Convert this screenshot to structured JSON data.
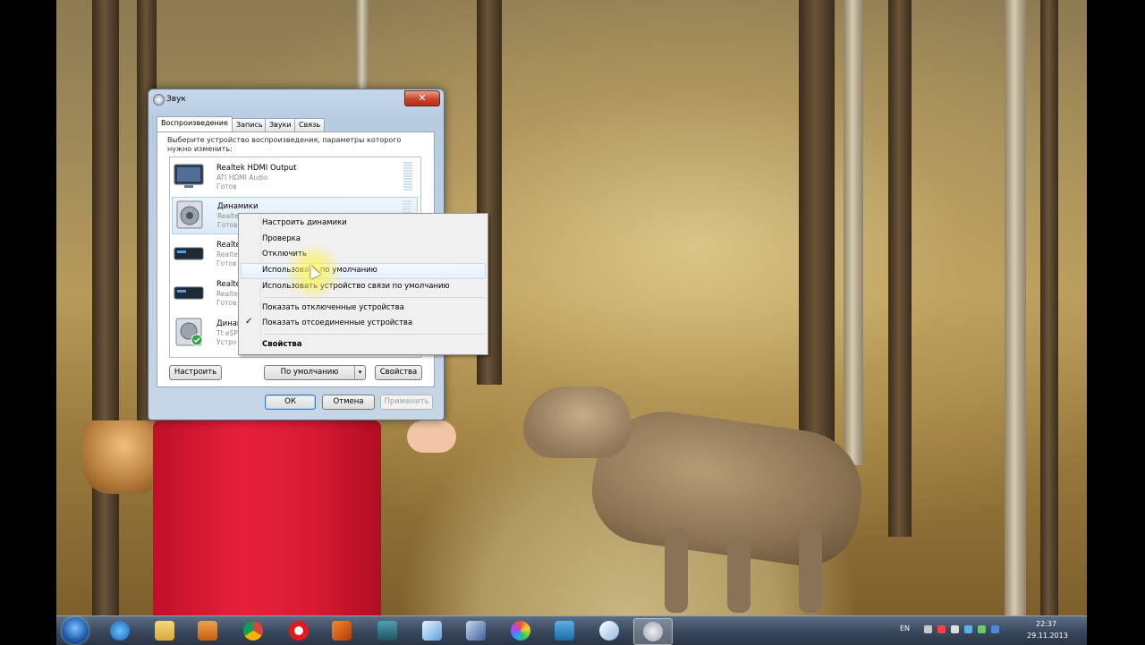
{
  "window": {
    "title": "Звук",
    "close_label": "✕",
    "tabs": [
      "Воспроизведение",
      "Запись",
      "Звуки",
      "Связь"
    ],
    "intro": "Выберите устройство воспроизведения, параметры которого нужно изменить:",
    "devices": [
      {
        "name": "Realtek HDMI Output",
        "sub": "ATI HDMI Audio",
        "status": "Готов"
      },
      {
        "name": "Динамики",
        "sub": "Realte",
        "status": "Готов"
      },
      {
        "name": "Realte",
        "sub": "Realte",
        "status": "Готов"
      },
      {
        "name": "Realte",
        "sub": "Realte",
        "status": "Готов"
      },
      {
        "name": "Динам",
        "sub": "Tt eSP",
        "status": "Устро"
      }
    ],
    "buttons": {
      "configure": "Настроить",
      "default": "По умолчанию",
      "default_arrow": "▾",
      "properties": "Свойства",
      "ok": "ОК",
      "cancel": "Отмена",
      "apply": "Применить"
    }
  },
  "context_menu": {
    "items": [
      "Настроить динамики",
      "Проверка",
      "Отключить",
      "Использовать по умолчанию",
      "Использовать устройство связи по умолчанию",
      "Показать отключенные устройства",
      "Показать отсоединенные устройства",
      "Свойства"
    ],
    "check_mark": "✓"
  },
  "taskbar": {
    "language": "EN",
    "time": "22:37",
    "date": "29.11.2013",
    "pinned_icons": [
      "start-orb-icon",
      "ie-icon",
      "explorer-icon",
      "media-player-icon",
      "chrome-icon",
      "opera-icon",
      "matlab-icon",
      "maya-icon",
      "cube-icon",
      "virtualbox-icon",
      "picasa-icon",
      "book-icon",
      "paint-icon",
      "sound-icon"
    ]
  }
}
